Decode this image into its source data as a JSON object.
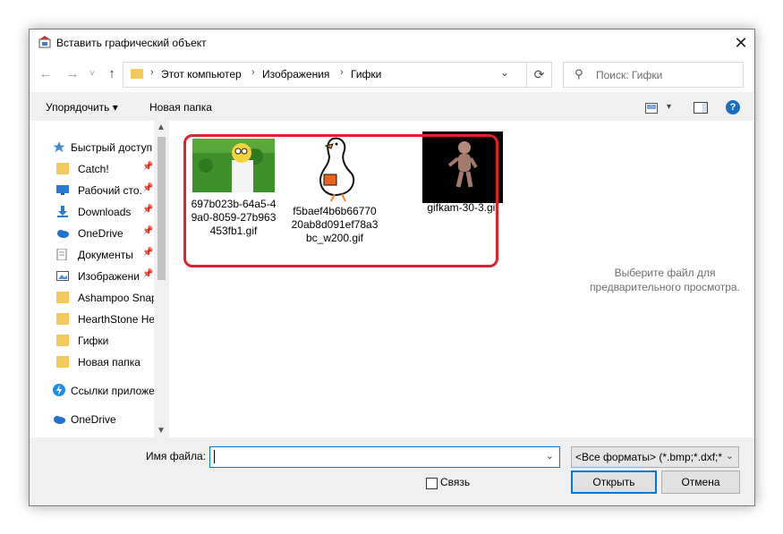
{
  "window": {
    "title": "Вставить графический объект",
    "close_glyph": "✕"
  },
  "nav": {
    "back_glyph": "←",
    "forward_glyph": "→",
    "recent_glyph": "˅",
    "up_glyph": "↑",
    "breadcrumb": [
      "Этот компьютер",
      "Изображения",
      "Гифки"
    ],
    "breadcrumb_sep": "›",
    "dropdown_glyph": "⌄",
    "refresh_glyph": "⟳",
    "search_icon_glyph": "⚲",
    "search_placeholder": "Поиск: Гифки"
  },
  "toolbar": {
    "organize_label": "Упорядочить ▾",
    "new_folder_label": "Новая папка",
    "view_dd_glyph": "▾",
    "help_glyph": "?"
  },
  "sidebar": {
    "items": [
      {
        "label": "Быстрый доступ",
        "icon": "star-icon",
        "pinned": false
      },
      {
        "label": "Catch!",
        "icon": "folder-icon",
        "pinned": true
      },
      {
        "label": "Рабочий сто...",
        "icon": "desktop-icon",
        "pinned": true
      },
      {
        "label": "Downloads",
        "icon": "download-icon",
        "pinned": true
      },
      {
        "label": "OneDrive",
        "icon": "cloud-icon",
        "pinned": true
      },
      {
        "label": "Документы",
        "icon": "documents-icon",
        "pinned": true
      },
      {
        "label": "Изображени",
        "icon": "pictures-icon",
        "pinned": true
      },
      {
        "label": "Ashampoo Snap",
        "icon": "folder-icon",
        "pinned": false
      },
      {
        "label": "HearthStone  He",
        "icon": "folder-icon",
        "pinned": false
      },
      {
        "label": "Гифки",
        "icon": "folder-icon",
        "pinned": false
      },
      {
        "label": "Новая папка",
        "icon": "folder-icon",
        "pinned": false
      },
      {
        "label": "Ссылки приложе",
        "icon": "lightning-icon",
        "pinned": false
      },
      {
        "label": "OneDrive",
        "icon": "cloud-icon",
        "pinned": false
      }
    ],
    "pin_glyph": "📌",
    "scroll_up_glyph": "▲",
    "scroll_down_glyph": "▼"
  },
  "files": [
    {
      "name": "697b023b-64a5-49a0-8059-27b963453fb1.gif",
      "line1": "697b023b-64a5-4",
      "line2": "9a0-8059-27b963",
      "line3": "453fb1.gif"
    },
    {
      "name": "f5baef4b6b6677020ab8d091ef78a3bc_w200.gif",
      "line1": "f5baef4b6b66770",
      "line2": "20ab8d091ef78a3",
      "line3": "bc_w200.gif"
    },
    {
      "name": "gifkam-30-3.gif",
      "line1": "gifkam-30-3.gif",
      "line2": "",
      "line3": ""
    }
  ],
  "preview_text": {
    "line1": "Выберите файл для",
    "line2": "предварительного просмотра."
  },
  "bottom": {
    "filename_label": "Имя файла:",
    "filename_value": "",
    "filetype_value": "<Все форматы> (*.bmp;*.dxf;*",
    "dd_glyph": "⌄",
    "link_label": "Связь",
    "open_label": "Открыть",
    "cancel_label": "Отмена"
  },
  "colors": {
    "highlight": "#e0202a",
    "accent": "#0078d7",
    "folder": "#f3c95c"
  }
}
